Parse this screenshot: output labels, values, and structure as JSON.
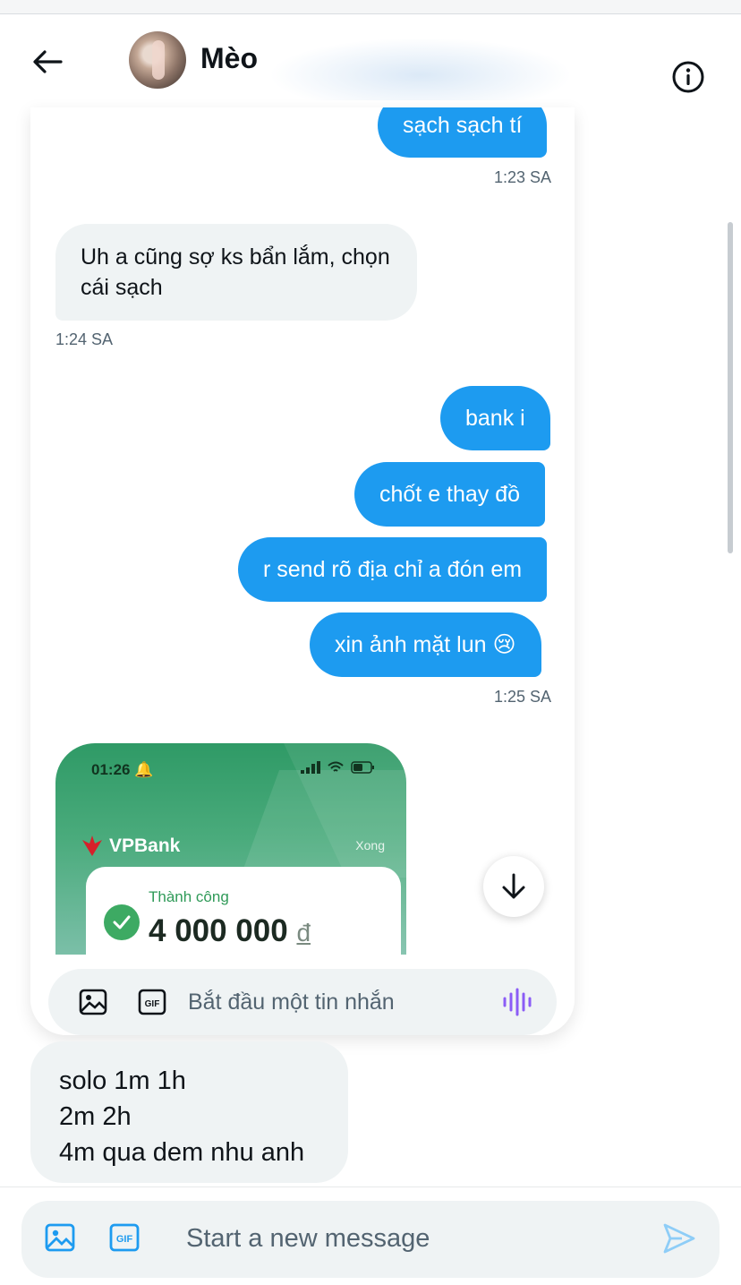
{
  "header": {
    "contact_name": "Mèo"
  },
  "screenshot": {
    "messages": [
      {
        "text": "sạch sạch tí",
        "direction": "out"
      },
      {
        "text": "1:23 SA",
        "kind": "timestamp"
      },
      {
        "text": "Uh a cũng sợ ks bẩn lắm, chọn cái sạch",
        "direction": "in"
      },
      {
        "text": "1:24 SA",
        "kind": "timestamp"
      },
      {
        "text": "bank i",
        "direction": "out"
      },
      {
        "text": "chốt e thay đồ",
        "direction": "out"
      },
      {
        "text": "r send rõ địa chỉ a đón em",
        "direction": "out"
      },
      {
        "text": "xin ảnh mặt lun 😢",
        "direction": "out"
      },
      {
        "text": "1:25 SA",
        "kind": "timestamp"
      }
    ],
    "bank_receipt": {
      "time": "01:26",
      "bank_name": "VPBank",
      "done_label": "Xong",
      "status": "Thành công",
      "amount": "4 000 000",
      "currency": "đ"
    },
    "compose_placeholder": "Bắt đầu một tin nhắn"
  },
  "caption_message": {
    "lines": [
      "solo 1m 1h",
      "2m 2h",
      "4m qua dem nhu anh"
    ]
  },
  "compose": {
    "placeholder": "Start a new message"
  },
  "colors": {
    "accent": "#1d9bf0",
    "incoming_bubble": "#eff3f4",
    "bank_green": "#2f9a66"
  },
  "icons": [
    "back-arrow-icon",
    "info-icon",
    "image-icon",
    "gif-icon",
    "voice-icon",
    "arrow-down-icon",
    "send-icon"
  ]
}
